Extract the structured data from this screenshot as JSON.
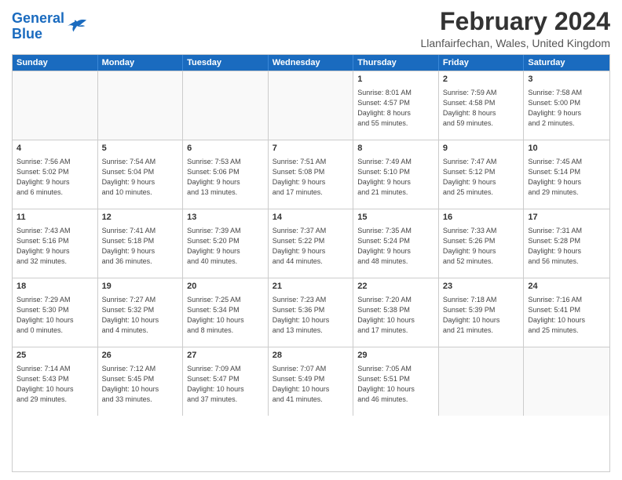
{
  "logo": {
    "line1": "General",
    "line2": "Blue"
  },
  "title": "February 2024",
  "location": "Llanfairfechan, Wales, United Kingdom",
  "days_of_week": [
    "Sunday",
    "Monday",
    "Tuesday",
    "Wednesday",
    "Thursday",
    "Friday",
    "Saturday"
  ],
  "weeks": [
    [
      {
        "day": "",
        "empty": true
      },
      {
        "day": "",
        "empty": true
      },
      {
        "day": "",
        "empty": true
      },
      {
        "day": "",
        "empty": true
      },
      {
        "day": "1",
        "info": "Sunrise: 8:01 AM\nSunset: 4:57 PM\nDaylight: 8 hours\nand 55 minutes."
      },
      {
        "day": "2",
        "info": "Sunrise: 7:59 AM\nSunset: 4:58 PM\nDaylight: 8 hours\nand 59 minutes."
      },
      {
        "day": "3",
        "info": "Sunrise: 7:58 AM\nSunset: 5:00 PM\nDaylight: 9 hours\nand 2 minutes."
      }
    ],
    [
      {
        "day": "4",
        "info": "Sunrise: 7:56 AM\nSunset: 5:02 PM\nDaylight: 9 hours\nand 6 minutes."
      },
      {
        "day": "5",
        "info": "Sunrise: 7:54 AM\nSunset: 5:04 PM\nDaylight: 9 hours\nand 10 minutes."
      },
      {
        "day": "6",
        "info": "Sunrise: 7:53 AM\nSunset: 5:06 PM\nDaylight: 9 hours\nand 13 minutes."
      },
      {
        "day": "7",
        "info": "Sunrise: 7:51 AM\nSunset: 5:08 PM\nDaylight: 9 hours\nand 17 minutes."
      },
      {
        "day": "8",
        "info": "Sunrise: 7:49 AM\nSunset: 5:10 PM\nDaylight: 9 hours\nand 21 minutes."
      },
      {
        "day": "9",
        "info": "Sunrise: 7:47 AM\nSunset: 5:12 PM\nDaylight: 9 hours\nand 25 minutes."
      },
      {
        "day": "10",
        "info": "Sunrise: 7:45 AM\nSunset: 5:14 PM\nDaylight: 9 hours\nand 29 minutes."
      }
    ],
    [
      {
        "day": "11",
        "info": "Sunrise: 7:43 AM\nSunset: 5:16 PM\nDaylight: 9 hours\nand 32 minutes."
      },
      {
        "day": "12",
        "info": "Sunrise: 7:41 AM\nSunset: 5:18 PM\nDaylight: 9 hours\nand 36 minutes."
      },
      {
        "day": "13",
        "info": "Sunrise: 7:39 AM\nSunset: 5:20 PM\nDaylight: 9 hours\nand 40 minutes."
      },
      {
        "day": "14",
        "info": "Sunrise: 7:37 AM\nSunset: 5:22 PM\nDaylight: 9 hours\nand 44 minutes."
      },
      {
        "day": "15",
        "info": "Sunrise: 7:35 AM\nSunset: 5:24 PM\nDaylight: 9 hours\nand 48 minutes."
      },
      {
        "day": "16",
        "info": "Sunrise: 7:33 AM\nSunset: 5:26 PM\nDaylight: 9 hours\nand 52 minutes."
      },
      {
        "day": "17",
        "info": "Sunrise: 7:31 AM\nSunset: 5:28 PM\nDaylight: 9 hours\nand 56 minutes."
      }
    ],
    [
      {
        "day": "18",
        "info": "Sunrise: 7:29 AM\nSunset: 5:30 PM\nDaylight: 10 hours\nand 0 minutes."
      },
      {
        "day": "19",
        "info": "Sunrise: 7:27 AM\nSunset: 5:32 PM\nDaylight: 10 hours\nand 4 minutes."
      },
      {
        "day": "20",
        "info": "Sunrise: 7:25 AM\nSunset: 5:34 PM\nDaylight: 10 hours\nand 8 minutes."
      },
      {
        "day": "21",
        "info": "Sunrise: 7:23 AM\nSunset: 5:36 PM\nDaylight: 10 hours\nand 13 minutes."
      },
      {
        "day": "22",
        "info": "Sunrise: 7:20 AM\nSunset: 5:38 PM\nDaylight: 10 hours\nand 17 minutes."
      },
      {
        "day": "23",
        "info": "Sunrise: 7:18 AM\nSunset: 5:39 PM\nDaylight: 10 hours\nand 21 minutes."
      },
      {
        "day": "24",
        "info": "Sunrise: 7:16 AM\nSunset: 5:41 PM\nDaylight: 10 hours\nand 25 minutes."
      }
    ],
    [
      {
        "day": "25",
        "info": "Sunrise: 7:14 AM\nSunset: 5:43 PM\nDaylight: 10 hours\nand 29 minutes."
      },
      {
        "day": "26",
        "info": "Sunrise: 7:12 AM\nSunset: 5:45 PM\nDaylight: 10 hours\nand 33 minutes."
      },
      {
        "day": "27",
        "info": "Sunrise: 7:09 AM\nSunset: 5:47 PM\nDaylight: 10 hours\nand 37 minutes."
      },
      {
        "day": "28",
        "info": "Sunrise: 7:07 AM\nSunset: 5:49 PM\nDaylight: 10 hours\nand 41 minutes."
      },
      {
        "day": "29",
        "info": "Sunrise: 7:05 AM\nSunset: 5:51 PM\nDaylight: 10 hours\nand 46 minutes."
      },
      {
        "day": "",
        "empty": true
      },
      {
        "day": "",
        "empty": true
      }
    ]
  ]
}
